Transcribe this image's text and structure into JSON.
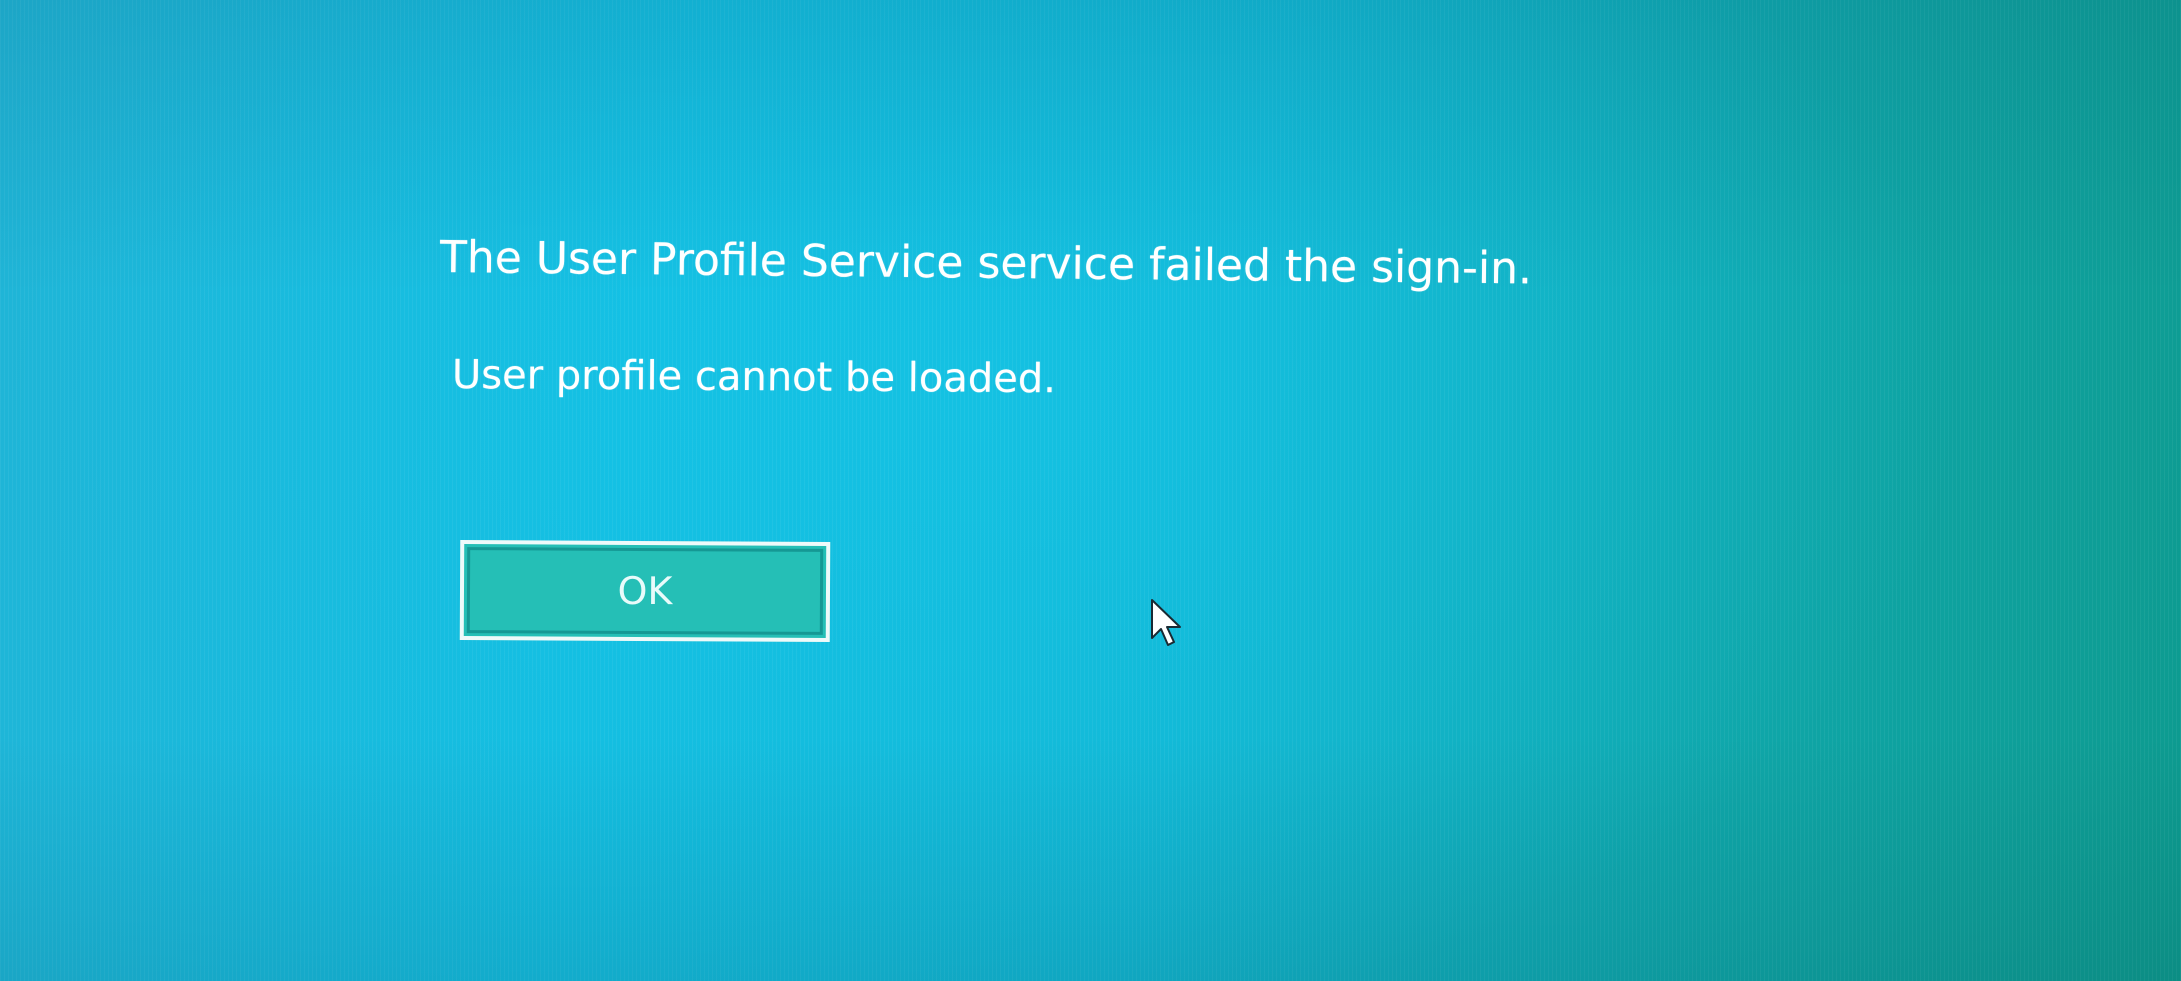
{
  "dialog": {
    "title": "The User Profile Service service failed the sign-in.",
    "detail": "User profile cannot be loaded.",
    "ok_label": "OK"
  },
  "icons": {
    "pointer": "mouse-pointer-icon"
  },
  "colors": {
    "background": "#14bde0",
    "button_fill": "#25bfb6",
    "text": "#ffffff"
  }
}
